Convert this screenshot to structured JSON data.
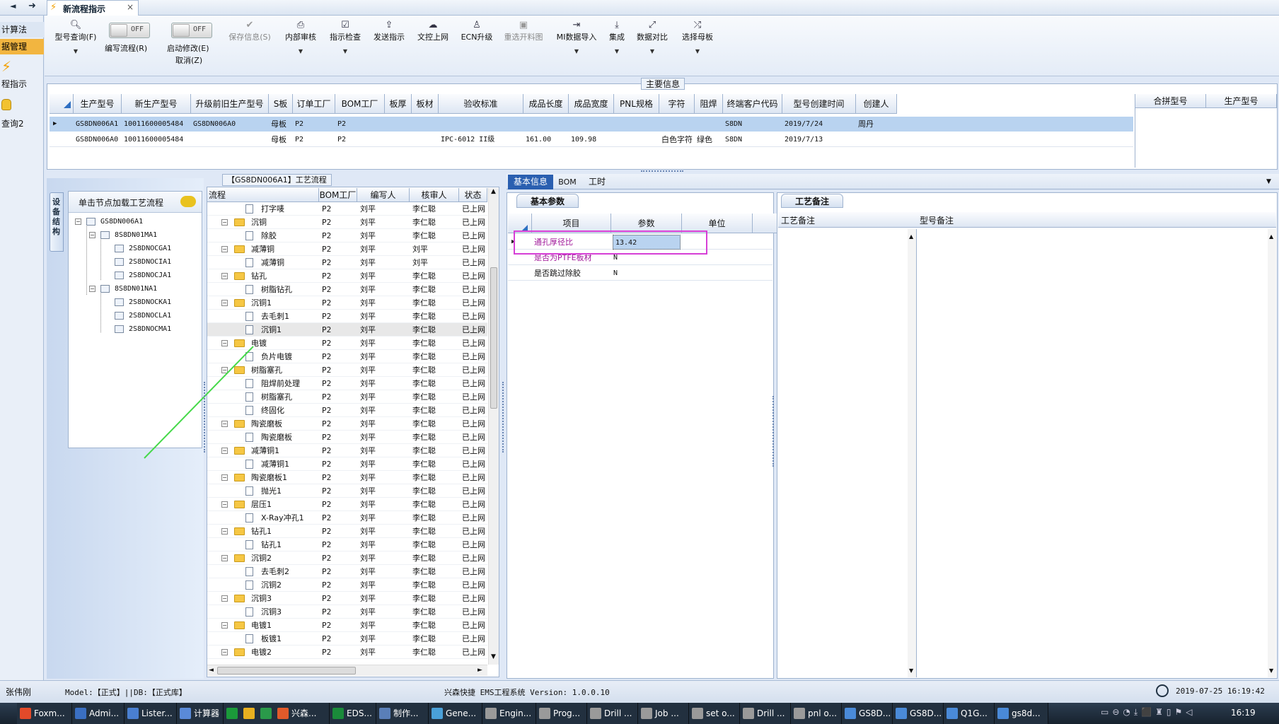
{
  "app": {
    "doc_tab": "新流程指示",
    "close": "×",
    "nav_back": "◄",
    "nav_fwd": "➜"
  },
  "left_nav": {
    "items": [
      "计算法",
      "据管理",
      "程指示",
      "查询2"
    ]
  },
  "toolbar": {
    "buttons": [
      {
        "label": "型号查询(F)",
        "icon": "search-icon"
      },
      {
        "label": "编写流程(R)",
        "icon": "toggle"
      },
      {
        "label": "启动修改(E)",
        "icon": "toggle"
      },
      {
        "label": "取消(Z)",
        "icon": ""
      },
      {
        "label": "保存信息(S)",
        "icon": "check-icon"
      },
      {
        "label": "内部审核",
        "icon": "printer-icon"
      },
      {
        "label": "指示检查",
        "icon": "checkbox-icon"
      },
      {
        "label": "发送指示",
        "icon": "upload-icon"
      },
      {
        "label": "文控上网",
        "icon": "cloud-icon"
      },
      {
        "label": "ECN升级",
        "icon": "person-icon"
      },
      {
        "label": "重选开料图",
        "icon": "image-icon"
      },
      {
        "label": "MI数据导入",
        "icon": "import-icon"
      },
      {
        "label": "集成",
        "icon": "download-icon"
      },
      {
        "label": "数据对比",
        "icon": "compare-icon"
      },
      {
        "label": "选择母板",
        "icon": "shuffle-icon"
      }
    ],
    "toggle_off": "OFF"
  },
  "main_info": {
    "title": "主要信息",
    "headers": [
      "生产型号",
      "新生产型号",
      "升级前旧生产型号",
      "S板",
      "订单工厂",
      "BOM工厂",
      "板厚",
      "板材",
      "验收标准",
      "成品长度",
      "成品宽度",
      "PNL规格",
      "字符",
      "阻焊",
      "终端客户代码",
      "型号创建时间",
      "创建人"
    ],
    "rows": [
      [
        "GS8DN006A1",
        "10011600005484",
        "GS8DN006A0",
        "母板",
        "P2",
        "P2",
        "",
        "",
        "",
        "",
        "",
        "",
        "",
        "",
        "S8DN",
        "2019/7/24",
        "周丹"
      ],
      [
        "GS8DN006A0",
        "10011600005484",
        "",
        "母板",
        "P2",
        "P2",
        "",
        "",
        "IPC-6012 II级",
        "161.00",
        "109.98",
        "",
        "白色字符",
        "绿色",
        "S8DN",
        "2019/7/13",
        ""
      ]
    ],
    "side_headers": [
      "合拼型号",
      "生产型号"
    ]
  },
  "device_panel": {
    "vertical_tab": "设备结构",
    "hint": "单击节点加载工艺流程",
    "tree": [
      {
        "label": "GS8DN006A1",
        "level": 0,
        "pm": "−"
      },
      {
        "label": "8S8DN01MA1",
        "level": 1,
        "pm": "−"
      },
      {
        "label": "2S8DNOCGA1",
        "level": 2,
        "pm": ""
      },
      {
        "label": "2S8DNOCIA1",
        "level": 2,
        "pm": ""
      },
      {
        "label": "2S8DNOCJA1",
        "level": 2,
        "pm": ""
      },
      {
        "label": "8S8DN01NA1",
        "level": 1,
        "pm": "−"
      },
      {
        "label": "2S8DNOCKA1",
        "level": 2,
        "pm": ""
      },
      {
        "label": "2S8DNOCLA1",
        "level": 2,
        "pm": ""
      },
      {
        "label": "2S8DNOCMA1",
        "level": 2,
        "pm": ""
      }
    ]
  },
  "flow": {
    "title": "【GS8DN006A1】工艺流程",
    "headers": [
      "流程",
      "BOM工厂",
      "编写人",
      "核审人",
      "状态"
    ],
    "rows": [
      {
        "name": "打字唛",
        "kind": "doc",
        "bom": "P2",
        "writer": "刘平",
        "reviewer": "李仁聪",
        "status": "已上网"
      },
      {
        "name": "沉铜",
        "kind": "folder",
        "bom": "P2",
        "writer": "刘平",
        "reviewer": "李仁聪",
        "status": "已上网"
      },
      {
        "name": "除胶",
        "kind": "doc",
        "bom": "P2",
        "writer": "刘平",
        "reviewer": "李仁聪",
        "status": "已上网"
      },
      {
        "name": "减薄铜",
        "kind": "folder",
        "bom": "P2",
        "writer": "刘平",
        "reviewer": "刘平",
        "status": "已上网"
      },
      {
        "name": "减薄铜",
        "kind": "doc",
        "bom": "P2",
        "writer": "刘平",
        "reviewer": "刘平",
        "status": "已上网"
      },
      {
        "name": "钻孔",
        "kind": "folder",
        "bom": "P2",
        "writer": "刘平",
        "reviewer": "李仁聪",
        "status": "已上网"
      },
      {
        "name": "树脂钻孔",
        "kind": "doc",
        "bom": "P2",
        "writer": "刘平",
        "reviewer": "李仁聪",
        "status": "已上网"
      },
      {
        "name": "沉铜1",
        "kind": "folder",
        "bom": "P2",
        "writer": "刘平",
        "reviewer": "李仁聪",
        "status": "已上网"
      },
      {
        "name": "去毛刺1",
        "kind": "doc",
        "bom": "P2",
        "writer": "刘平",
        "reviewer": "李仁聪",
        "status": "已上网"
      },
      {
        "name": "沉铜1",
        "kind": "doc",
        "bom": "P2",
        "writer": "刘平",
        "reviewer": "李仁聪",
        "status": "已上网"
      },
      {
        "name": "电镀",
        "kind": "folder",
        "bom": "P2",
        "writer": "刘平",
        "reviewer": "李仁聪",
        "status": "已上网"
      },
      {
        "name": "负片电镀",
        "kind": "doc",
        "bom": "P2",
        "writer": "刘平",
        "reviewer": "李仁聪",
        "status": "已上网"
      },
      {
        "name": "树脂塞孔",
        "kind": "folder",
        "bom": "P2",
        "writer": "刘平",
        "reviewer": "李仁聪",
        "status": "已上网"
      },
      {
        "name": "阻焊前处理",
        "kind": "doc",
        "bom": "P2",
        "writer": "刘平",
        "reviewer": "李仁聪",
        "status": "已上网"
      },
      {
        "name": "树脂塞孔",
        "kind": "doc",
        "bom": "P2",
        "writer": "刘平",
        "reviewer": "李仁聪",
        "status": "已上网"
      },
      {
        "name": "终固化",
        "kind": "doc",
        "bom": "P2",
        "writer": "刘平",
        "reviewer": "李仁聪",
        "status": "已上网"
      },
      {
        "name": "陶瓷磨板",
        "kind": "folder",
        "bom": "P2",
        "writer": "刘平",
        "reviewer": "李仁聪",
        "status": "已上网"
      },
      {
        "name": "陶瓷磨板",
        "kind": "doc",
        "bom": "P2",
        "writer": "刘平",
        "reviewer": "李仁聪",
        "status": "已上网"
      },
      {
        "name": "减薄铜1",
        "kind": "folder",
        "bom": "P2",
        "writer": "刘平",
        "reviewer": "李仁聪",
        "status": "已上网"
      },
      {
        "name": "减薄铜1",
        "kind": "doc",
        "bom": "P2",
        "writer": "刘平",
        "reviewer": "李仁聪",
        "status": "已上网"
      },
      {
        "name": "陶瓷磨板1",
        "kind": "folder",
        "bom": "P2",
        "writer": "刘平",
        "reviewer": "李仁聪",
        "status": "已上网"
      },
      {
        "name": "抛光1",
        "kind": "doc",
        "bom": "P2",
        "writer": "刘平",
        "reviewer": "李仁聪",
        "status": "已上网"
      },
      {
        "name": "层压1",
        "kind": "folder",
        "bom": "P2",
        "writer": "刘平",
        "reviewer": "李仁聪",
        "status": "已上网"
      },
      {
        "name": "X-Ray冲孔1",
        "kind": "doc",
        "bom": "P2",
        "writer": "刘平",
        "reviewer": "李仁聪",
        "status": "已上网"
      },
      {
        "name": "钻孔1",
        "kind": "folder",
        "bom": "P2",
        "writer": "刘平",
        "reviewer": "李仁聪",
        "status": "已上网"
      },
      {
        "name": "钻孔1",
        "kind": "doc",
        "bom": "P2",
        "writer": "刘平",
        "reviewer": "李仁聪",
        "status": "已上网"
      },
      {
        "name": "沉铜2",
        "kind": "folder",
        "bom": "P2",
        "writer": "刘平",
        "reviewer": "李仁聪",
        "status": "已上网"
      },
      {
        "name": "去毛刺2",
        "kind": "doc",
        "bom": "P2",
        "writer": "刘平",
        "reviewer": "李仁聪",
        "status": "已上网"
      },
      {
        "name": "沉铜2",
        "kind": "doc",
        "bom": "P2",
        "writer": "刘平",
        "reviewer": "李仁聪",
        "status": "已上网"
      },
      {
        "name": "沉铜3",
        "kind": "folder",
        "bom": "P2",
        "writer": "刘平",
        "reviewer": "李仁聪",
        "status": "已上网"
      },
      {
        "name": "沉铜3",
        "kind": "doc",
        "bom": "P2",
        "writer": "刘平",
        "reviewer": "李仁聪",
        "status": "已上网"
      },
      {
        "name": "电镀1",
        "kind": "folder",
        "bom": "P2",
        "writer": "刘平",
        "reviewer": "李仁聪",
        "status": "已上网"
      },
      {
        "name": "板镀1",
        "kind": "doc",
        "bom": "P2",
        "writer": "刘平",
        "reviewer": "李仁聪",
        "status": "已上网"
      },
      {
        "name": "电镀2",
        "kind": "folder",
        "bom": "P2",
        "writer": "刘平",
        "reviewer": "李仁聪",
        "status": "已上网"
      }
    ]
  },
  "detail_tabs": [
    "基本信息",
    "BOM",
    "工时"
  ],
  "basic_params": {
    "tab": "基本参数",
    "headers": [
      "项目",
      "参数",
      "单位"
    ],
    "rows": [
      {
        "item": "通孔厚径比",
        "value": "13.42",
        "unit": ""
      },
      {
        "item": "是否为PTFE板材",
        "value": "N",
        "unit": ""
      },
      {
        "item": "是否跳过除胶",
        "value": "N",
        "unit": ""
      }
    ]
  },
  "process_notes": {
    "tab": "工艺备注",
    "col1": "工艺备注",
    "col2": "型号备注"
  },
  "status_bar": {
    "user": "张伟刚",
    "model": "Model:【正式】||DB:【正式库】",
    "system": "兴森快捷 EMS工程系统 Version: 1.0.0.10",
    "datetime": "2019-07-25 16:19:42"
  },
  "taskbar": {
    "items": [
      "Foxm...",
      "Admi...",
      "Lister...",
      "计算器",
      "",
      "",
      "",
      "兴森...",
      "EDS...",
      "制作...",
      "Gene...",
      "Engin...",
      "Prog...",
      "Drill ...",
      "Job ...",
      "set o...",
      "Drill ...",
      "pnl o...",
      "GS8D...",
      "GS8D...",
      "Q1G...",
      "gs8d..."
    ],
    "clock": "16:19"
  },
  "colors": {
    "accent": "#2a5fb0",
    "grid_header": "#dde6f3",
    "selected_row": "#b9d3f0",
    "highlight_box": "#d63fd6",
    "magenta_text": "#a0189a"
  }
}
